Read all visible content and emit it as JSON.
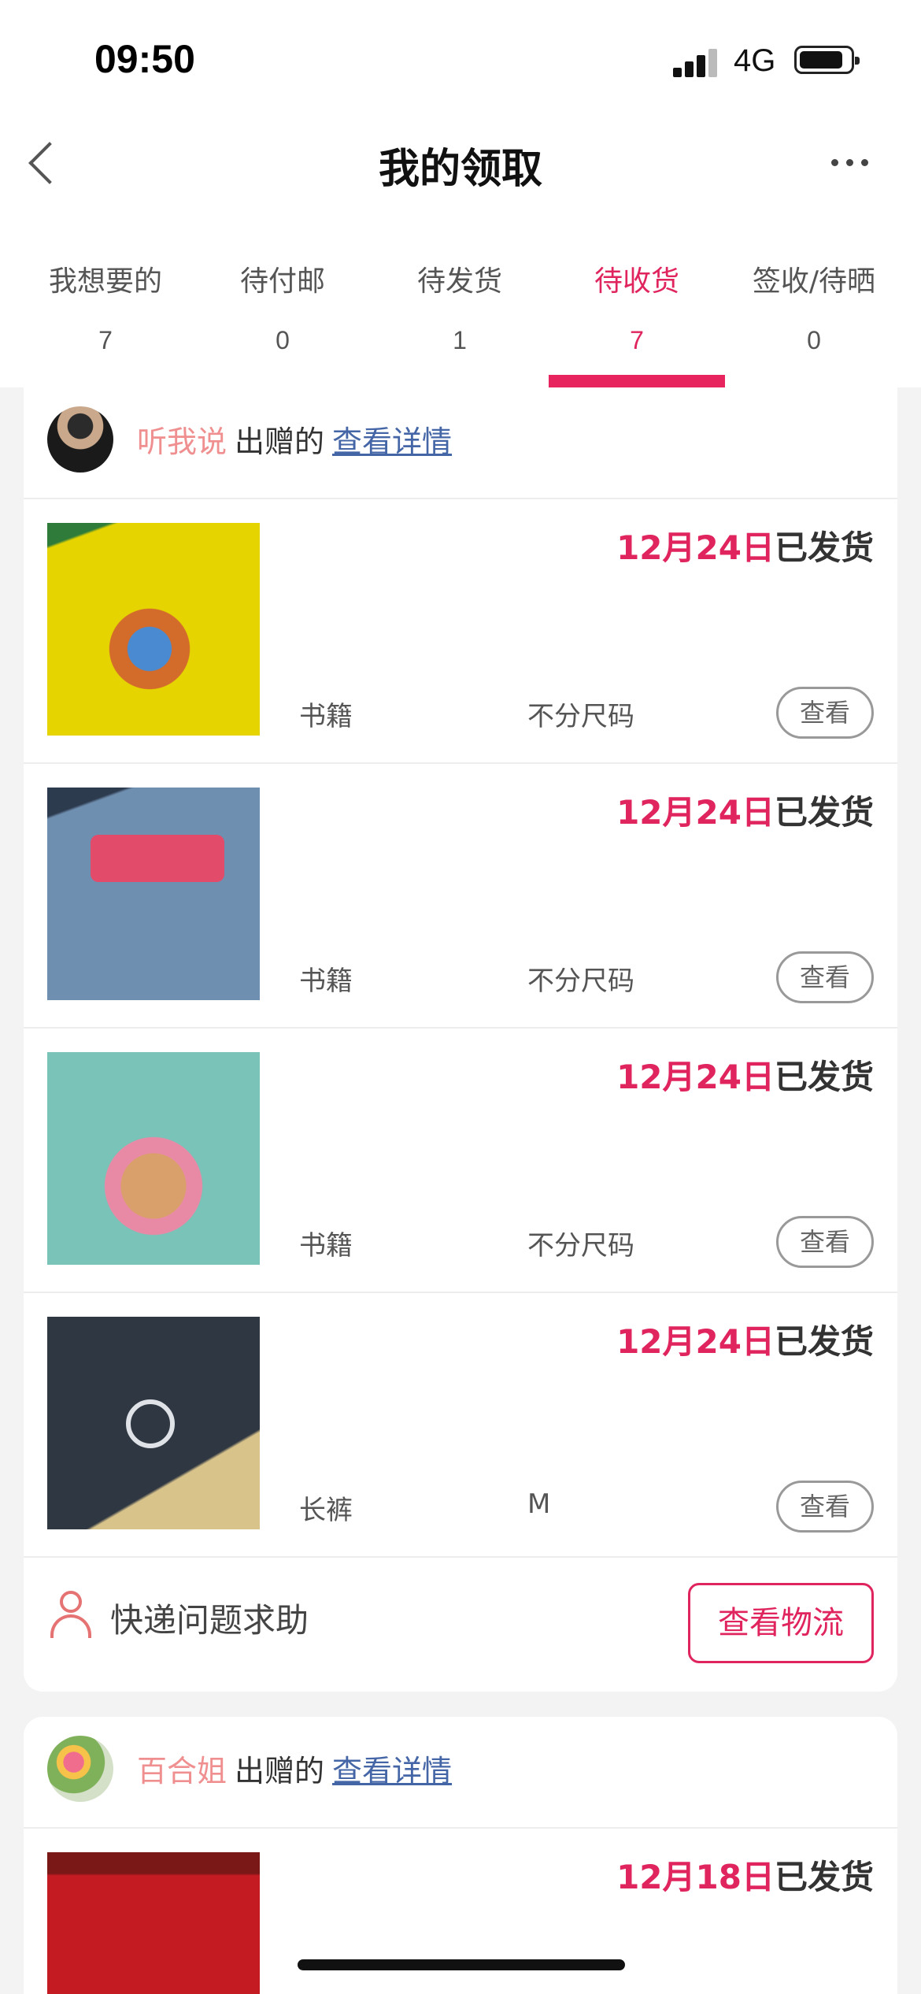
{
  "status_bar": {
    "time": "09:50",
    "network": "4G"
  },
  "header": {
    "title": "我的领取"
  },
  "tabs": [
    {
      "label": "我想要的",
      "count": "7",
      "active": false
    },
    {
      "label": "待付邮",
      "count": "0",
      "active": false
    },
    {
      "label": "待发货",
      "count": "1",
      "active": false
    },
    {
      "label": "待收货",
      "count": "7",
      "active": true
    },
    {
      "label": "签收/待晒",
      "count": "0",
      "active": false
    }
  ],
  "orders": [
    {
      "owner_name": "听我说",
      "gave_text": "出赠的",
      "detail_link": "查看详情",
      "items": [
        {
          "date": "12月24日",
          "status": "已发货",
          "category": "书籍",
          "size": "不分尺码",
          "view_label": "查看"
        },
        {
          "date": "12月24日",
          "status": "已发货",
          "category": "书籍",
          "size": "不分尺码",
          "view_label": "查看"
        },
        {
          "date": "12月24日",
          "status": "已发货",
          "category": "书籍",
          "size": "不分尺码",
          "view_label": "查看"
        },
        {
          "date": "12月24日",
          "status": "已发货",
          "category": "长裤",
          "size": "M",
          "view_label": "查看"
        }
      ],
      "help_text": "快递问题求助",
      "logistics_label": "查看物流"
    },
    {
      "owner_name": "百合姐",
      "gave_text": "出赠的",
      "detail_link": "查看详情",
      "items": [
        {
          "date": "12月18日",
          "status": "已发货"
        }
      ]
    }
  ],
  "colors": {
    "accent": "#e0245e",
    "owner_name": "#f08f8f",
    "link": "#4566a6"
  }
}
